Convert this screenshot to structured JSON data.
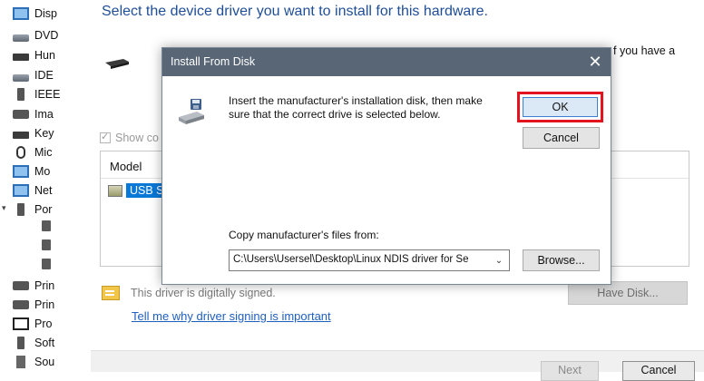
{
  "device_tree": {
    "items": [
      {
        "label": "Disp",
        "icon": "display-adapter-icon"
      },
      {
        "label": "DVD",
        "icon": "dvd-drive-icon"
      },
      {
        "label": "Hun",
        "icon": "hid-icon"
      },
      {
        "label": "IDE",
        "icon": "ide-controller-icon"
      },
      {
        "label": "IEEE",
        "icon": "ieee1394-icon"
      },
      {
        "label": "Ima",
        "icon": "imaging-device-icon"
      },
      {
        "label": "Key",
        "icon": "keyboard-icon"
      },
      {
        "label": "Mic",
        "icon": "mouse-icon"
      },
      {
        "label": "Mo",
        "icon": "monitor-icon"
      },
      {
        "label": "Net",
        "icon": "network-adapter-icon"
      },
      {
        "label": "Por",
        "icon": "ports-icon"
      },
      {
        "label": "Prin",
        "icon": "print-queue-icon"
      },
      {
        "label": "Prin",
        "icon": "printer-icon"
      },
      {
        "label": "Pro",
        "icon": "processor-icon"
      },
      {
        "label": "Soft",
        "icon": "software-device-icon"
      },
      {
        "label": "Sou",
        "icon": "sound-icon"
      }
    ]
  },
  "wizard": {
    "heading": "Select the device driver you want to install for this hardware.",
    "side_text": "f you have a",
    "show_compatible_label": "Show co",
    "model_header": "Model",
    "model_item": "USB Se",
    "signed_text": "This driver is digitally signed.",
    "signing_link": "Tell me why driver signing is important",
    "have_disk_label": "Have Disk...",
    "next_label": "Next",
    "cancel_label": "Cancel"
  },
  "dialog": {
    "title": "Install From Disk",
    "close_glyph": "✕",
    "message": "Insert the manufacturer's installation disk, then make sure that the correct drive is selected below.",
    "ok_label": "OK",
    "cancel_label": "Cancel",
    "copy_label": "Copy manufacturer's files from:",
    "path_value": "C:\\Users\\Usersel\\Desktop\\Linux NDIS driver for Se",
    "browse_label": "Browse...",
    "highlight_color": "#e3131f",
    "titlebar_color": "#586676"
  }
}
